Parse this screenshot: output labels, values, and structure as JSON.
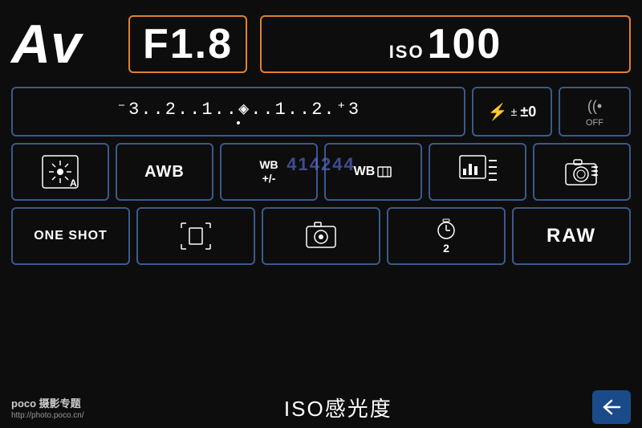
{
  "header": {
    "mode_label": "Av",
    "aperture_label": "F1.8",
    "iso_super": "ISO",
    "iso_value": "100"
  },
  "exposure": {
    "scale": "⁻3..2..1..0..1..2.⁺3",
    "scale_text": "-3..2..1..0..1..2.+3"
  },
  "flash": {
    "label": "±0"
  },
  "wifi": {
    "label": "OFF"
  },
  "row3": {
    "metering_label": "A",
    "awb_label": "AWB",
    "wb_plus_label": "WB\n+/-",
    "wb_bracket_label": "WB",
    "image_style_label": "",
    "camera_label": ""
  },
  "row4": {
    "oneshot_label": "ONE SHOT",
    "raw_label": "RAW"
  },
  "bottom": {
    "poco_line1": "poco 摄影专题",
    "poco_line2": "http://photo.poco.cn/",
    "iso_label": "ISO感光度"
  },
  "watermark": "414244"
}
